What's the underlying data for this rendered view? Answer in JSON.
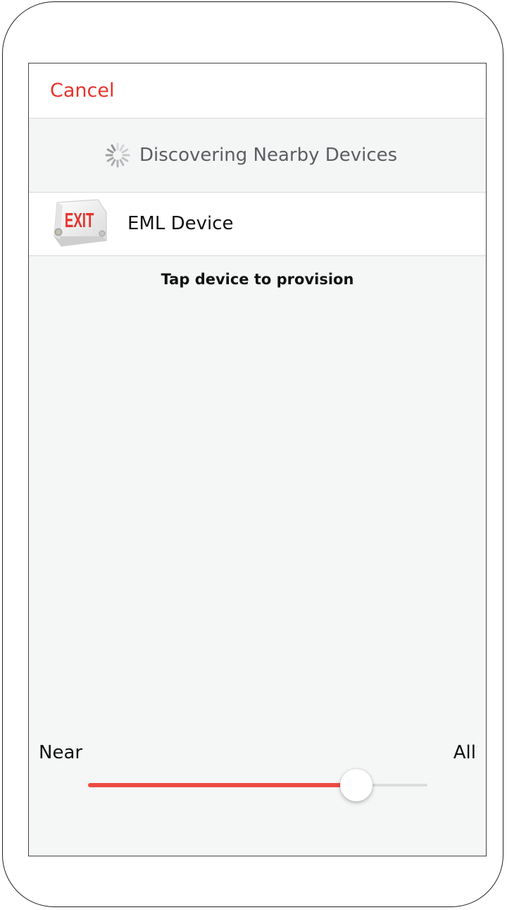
{
  "nav": {
    "cancel_label": "Cancel"
  },
  "discovery": {
    "status_text": "Discovering Nearby Devices",
    "spinner_icon": "activity-spinner-icon"
  },
  "devices": [
    {
      "name": "EML Device",
      "thumbnail_icon": "exit-sign-icon",
      "thumbnail_text": "EXIT"
    }
  ],
  "hint": "Tap device to provision",
  "range": {
    "min_label": "Near",
    "max_label": "All",
    "value_fraction": 0.79
  },
  "colors": {
    "accent": "#e8322b",
    "slider_fill": "#ee4b42",
    "status_text": "#5b5e63",
    "background": "#f5f6f6"
  }
}
